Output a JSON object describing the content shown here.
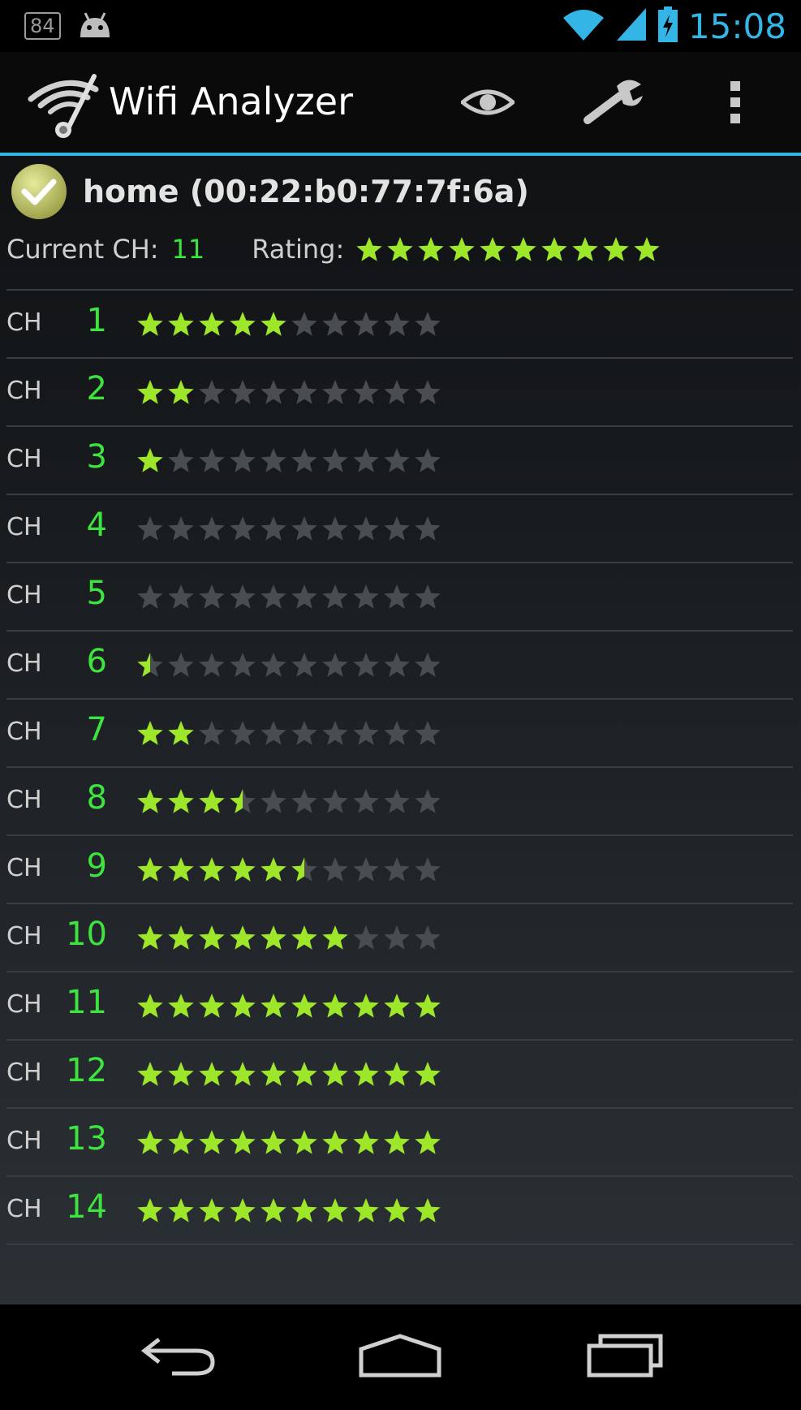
{
  "status_bar": {
    "notification_badge": "84",
    "time": "15:08",
    "icons": [
      "android-icon",
      "wifi-signal-icon",
      "cell-signal-icon",
      "battery-charging-icon"
    ]
  },
  "action_bar": {
    "title": "Wifi Analyzer",
    "actions": [
      "view-icon",
      "wrench-icon",
      "overflow-menu-icon"
    ]
  },
  "access_point": {
    "name": "home (00:22:b0:77:7f:6a)",
    "status": "connected"
  },
  "summary": {
    "current_ch_label": "Current CH:",
    "current_ch_value": "11",
    "rating_label": "Rating:",
    "rating": 10,
    "max_rating": 10
  },
  "channels": [
    {
      "label": "CH",
      "number": "1",
      "rating": 5
    },
    {
      "label": "CH",
      "number": "2",
      "rating": 2
    },
    {
      "label": "CH",
      "number": "3",
      "rating": 1
    },
    {
      "label": "CH",
      "number": "4",
      "rating": 0
    },
    {
      "label": "CH",
      "number": "5",
      "rating": 0
    },
    {
      "label": "CH",
      "number": "6",
      "rating": 0.5
    },
    {
      "label": "CH",
      "number": "7",
      "rating": 2
    },
    {
      "label": "CH",
      "number": "8",
      "rating": 3.5
    },
    {
      "label": "CH",
      "number": "9",
      "rating": 5.5
    },
    {
      "label": "CH",
      "number": "10",
      "rating": 7
    },
    {
      "label": "CH",
      "number": "11",
      "rating": 10
    },
    {
      "label": "CH",
      "number": "12",
      "rating": 10
    },
    {
      "label": "CH",
      "number": "13",
      "rating": 10
    },
    {
      "label": "CH",
      "number": "14",
      "rating": 10
    }
  ],
  "colors": {
    "accent": "#33b5e5",
    "channel_number": "#3fe33f",
    "star_on": "#9de62a",
    "star_off": "#4a4d50"
  },
  "nav_bar": {
    "buttons": [
      "back-icon",
      "home-icon",
      "recent-apps-icon"
    ]
  }
}
